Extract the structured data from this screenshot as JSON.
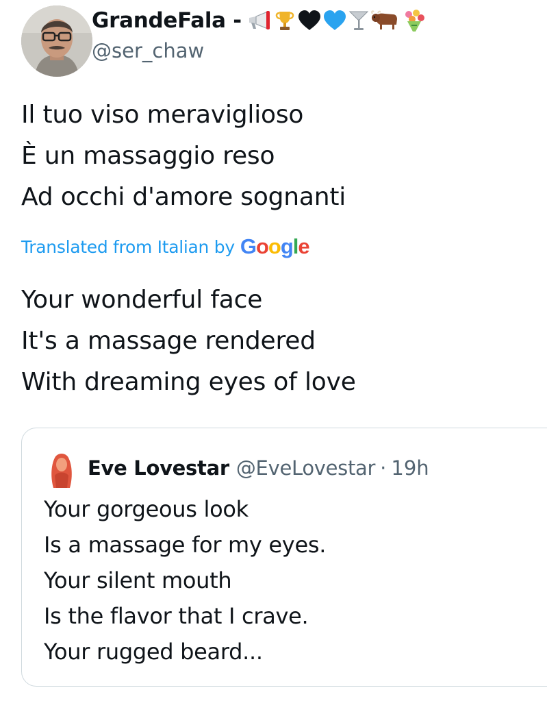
{
  "author": {
    "display_name": "GrandeFala -",
    "handle": "@ser_chaw",
    "name_emojis": [
      "megaphone-icon",
      "trophy-icon",
      "black-heart-icon",
      "blue-heart-icon",
      "cocktail-glass-icon",
      "ox-icon",
      "bouquet-icon"
    ]
  },
  "tweet": {
    "original_lines": [
      "Il tuo viso meraviglioso",
      "È un massaggio reso",
      "Ad occhi d'amore sognanti"
    ],
    "translated_label": "Translated from Italian by",
    "translator": {
      "letters": [
        "G",
        "o",
        "o",
        "g",
        "l",
        "e"
      ]
    },
    "translation_lines": [
      "Your wonderful face",
      "It's a massage rendered",
      "With dreaming eyes of love"
    ]
  },
  "quote": {
    "display_name": "Eve Lovestar",
    "handle": "@EveLovestar",
    "separator": "·",
    "time": "19h",
    "lines": [
      "Your gorgeous look",
      "Is a massage for my eyes.",
      "Your silent mouth",
      "Is the flavor that I crave.",
      "Your rugged beard..."
    ]
  },
  "colors": {
    "text": "#0f1419",
    "secondary": "#536471",
    "link": "#1d9bf0",
    "border": "#cfd9de"
  }
}
